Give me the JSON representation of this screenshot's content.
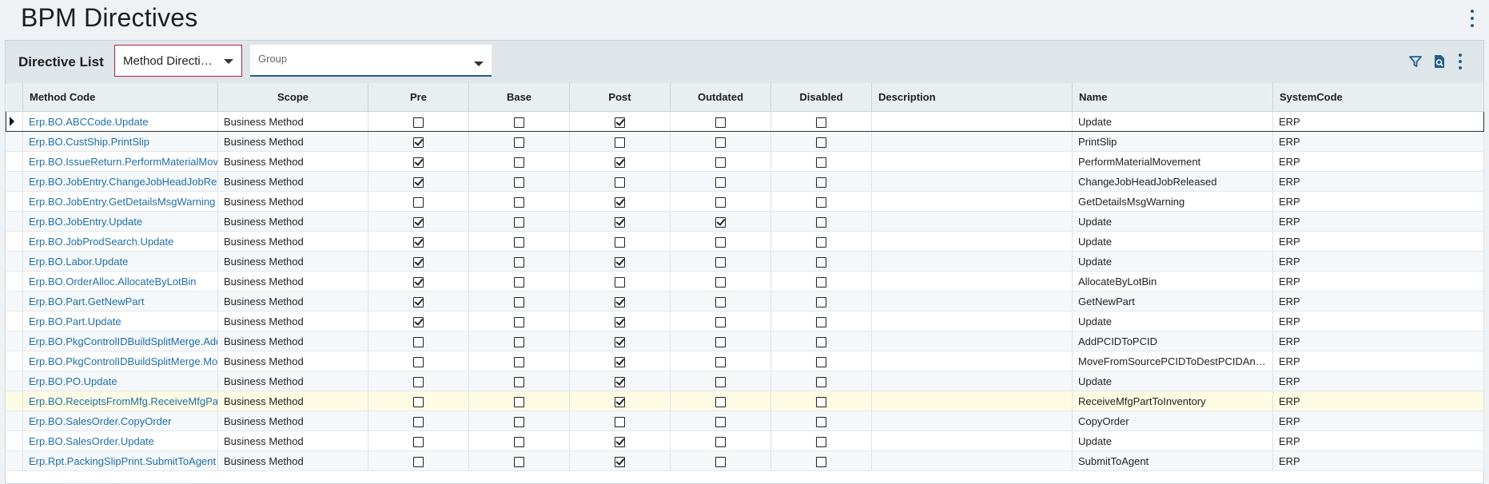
{
  "page": {
    "title": "BPM Directives"
  },
  "panel": {
    "title": "Directive List",
    "directive_type": "Method Directives",
    "directive_type_display": "Method Directi…",
    "group_label": "Group"
  },
  "icons": {
    "menu": "kebab-vertical-icon",
    "filter": "filter-icon",
    "search": "document-search-icon",
    "more": "kebab-vertical-icon"
  },
  "colors": {
    "accent": "#1f5f8b",
    "link": "#1f6fa8",
    "combo_border": "#b01e4b",
    "highlight_row": "#fdfbe3"
  },
  "columns": [
    "Method Code",
    "Scope",
    "Pre",
    "Base",
    "Post",
    "Outdated",
    "Disabled",
    "Description",
    "Name",
    "SystemCode"
  ],
  "rows": [
    {
      "method_code": "Erp.BO.ABCCode.Update",
      "scope": "Business Method",
      "pre": false,
      "base": false,
      "post": true,
      "outdated": false,
      "disabled": false,
      "description": "",
      "name": "Update",
      "system_code": "ERP",
      "selected": true
    },
    {
      "method_code": "Erp.BO.CustShip.PrintSlip",
      "scope": "Business Method",
      "pre": true,
      "base": false,
      "post": false,
      "outdated": false,
      "disabled": false,
      "description": "",
      "name": "PrintSlip",
      "system_code": "ERP"
    },
    {
      "method_code": "Erp.BO.IssueReturn.PerformMaterialMov",
      "scope": "Business Method",
      "pre": true,
      "base": false,
      "post": true,
      "outdated": false,
      "disabled": false,
      "description": "",
      "name": "PerformMaterialMovement",
      "system_code": "ERP"
    },
    {
      "method_code": "Erp.BO.JobEntry.ChangeJobHeadJobRel",
      "scope": "Business Method",
      "pre": true,
      "base": false,
      "post": false,
      "outdated": false,
      "disabled": false,
      "description": "",
      "name": "ChangeJobHeadJobReleased",
      "system_code": "ERP"
    },
    {
      "method_code": "Erp.BO.JobEntry.GetDetailsMsgWarning",
      "scope": "Business Method",
      "pre": false,
      "base": false,
      "post": true,
      "outdated": false,
      "disabled": false,
      "description": "",
      "name": "GetDetailsMsgWarning",
      "system_code": "ERP"
    },
    {
      "method_code": "Erp.BO.JobEntry.Update",
      "scope": "Business Method",
      "pre": true,
      "base": false,
      "post": true,
      "outdated": true,
      "disabled": false,
      "description": "",
      "name": "Update",
      "system_code": "ERP"
    },
    {
      "method_code": "Erp.BO.JobProdSearch.Update",
      "scope": "Business Method",
      "pre": true,
      "base": false,
      "post": false,
      "outdated": false,
      "disabled": false,
      "description": "",
      "name": "Update",
      "system_code": "ERP"
    },
    {
      "method_code": "Erp.BO.Labor.Update",
      "scope": "Business Method",
      "pre": true,
      "base": false,
      "post": true,
      "outdated": false,
      "disabled": false,
      "description": "",
      "name": "Update",
      "system_code": "ERP"
    },
    {
      "method_code": "Erp.BO.OrderAlloc.AllocateByLotBin",
      "scope": "Business Method",
      "pre": true,
      "base": false,
      "post": false,
      "outdated": false,
      "disabled": false,
      "description": "",
      "name": "AllocateByLotBin",
      "system_code": "ERP"
    },
    {
      "method_code": "Erp.BO.Part.GetNewPart",
      "scope": "Business Method",
      "pre": true,
      "base": false,
      "post": true,
      "outdated": false,
      "disabled": false,
      "description": "",
      "name": "GetNewPart",
      "system_code": "ERP"
    },
    {
      "method_code": "Erp.BO.Part.Update",
      "scope": "Business Method",
      "pre": true,
      "base": false,
      "post": true,
      "outdated": false,
      "disabled": false,
      "description": "",
      "name": "Update",
      "system_code": "ERP"
    },
    {
      "method_code": "Erp.BO.PkgControlIDBuildSplitMerge.Add",
      "scope": "Business Method",
      "pre": false,
      "base": false,
      "post": true,
      "outdated": false,
      "disabled": false,
      "description": "",
      "name": "AddPCIDToPCID",
      "system_code": "ERP"
    },
    {
      "method_code": "Erp.BO.PkgControlIDBuildSplitMerge.Mo",
      "scope": "Business Method",
      "pre": false,
      "base": false,
      "post": true,
      "outdated": false,
      "disabled": false,
      "description": "",
      "name": "MoveFromSourcePCIDToDestPCIDAnd…",
      "system_code": "ERP"
    },
    {
      "method_code": "Erp.BO.PO.Update",
      "scope": "Business Method",
      "pre": false,
      "base": false,
      "post": true,
      "outdated": false,
      "disabled": false,
      "description": "",
      "name": "Update",
      "system_code": "ERP"
    },
    {
      "method_code": "Erp.BO.ReceiptsFromMfg.ReceiveMfgPart",
      "scope": "Business Method",
      "pre": false,
      "base": false,
      "post": true,
      "outdated": false,
      "disabled": false,
      "description": "",
      "name": "ReceiveMfgPartToInventory",
      "system_code": "ERP",
      "highlight": true
    },
    {
      "method_code": "Erp.BO.SalesOrder.CopyOrder",
      "scope": "Business Method",
      "pre": false,
      "base": false,
      "post": false,
      "outdated": false,
      "disabled": false,
      "description": "",
      "name": "CopyOrder",
      "system_code": "ERP"
    },
    {
      "method_code": "Erp.BO.SalesOrder.Update",
      "scope": "Business Method",
      "pre": false,
      "base": false,
      "post": true,
      "outdated": false,
      "disabled": false,
      "description": "",
      "name": "Update",
      "system_code": "ERP"
    },
    {
      "method_code": "Erp.Rpt.PackingSlipPrint.SubmitToAgent",
      "scope": "Business Method",
      "pre": false,
      "base": false,
      "post": true,
      "outdated": false,
      "disabled": false,
      "description": "",
      "name": "SubmitToAgent",
      "system_code": "ERP"
    }
  ]
}
